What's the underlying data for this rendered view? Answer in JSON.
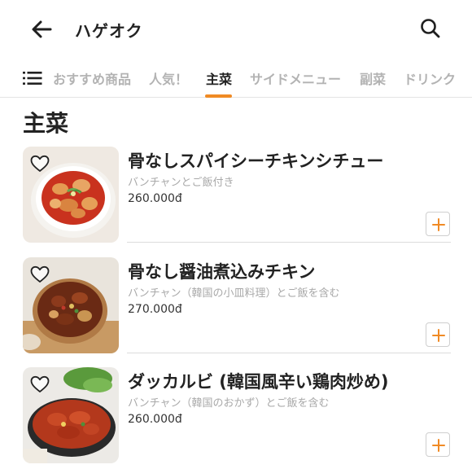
{
  "header": {
    "title": "ハゲオク",
    "back_icon": "arrow-left-icon",
    "search_icon": "search-icon"
  },
  "tabs": {
    "menu_icon": "list-menu-icon",
    "items": [
      {
        "label": "おすすめ商品",
        "active": false
      },
      {
        "label": "人気！",
        "active": false
      },
      {
        "label": "主菜",
        "active": true
      },
      {
        "label": "サイドメニュー",
        "active": false
      },
      {
        "label": "副菜",
        "active": false
      },
      {
        "label": "ドリンク",
        "active": false
      }
    ]
  },
  "section": {
    "title": "主菜"
  },
  "items": [
    {
      "name": "骨なしスパイシーチキンシチュー",
      "description": "バンチャンとご飯付き",
      "price": "260.000đ"
    },
    {
      "name": "骨なし醤油煮込みチキン",
      "description": "バンチャン（韓国の小皿料理）とご飯を含む",
      "price": "270.000đ"
    },
    {
      "name": "ダッカルビ (韓国風辛い鶏肉炒め)",
      "description": "バンチャン（韓国のおかず）とご飯を含む",
      "price": "260.000đ"
    }
  ],
  "colors": {
    "accent": "#f08a24",
    "tab_inactive": "#b3b3b3",
    "text_primary": "#222222",
    "text_muted": "#a9a9a9"
  }
}
